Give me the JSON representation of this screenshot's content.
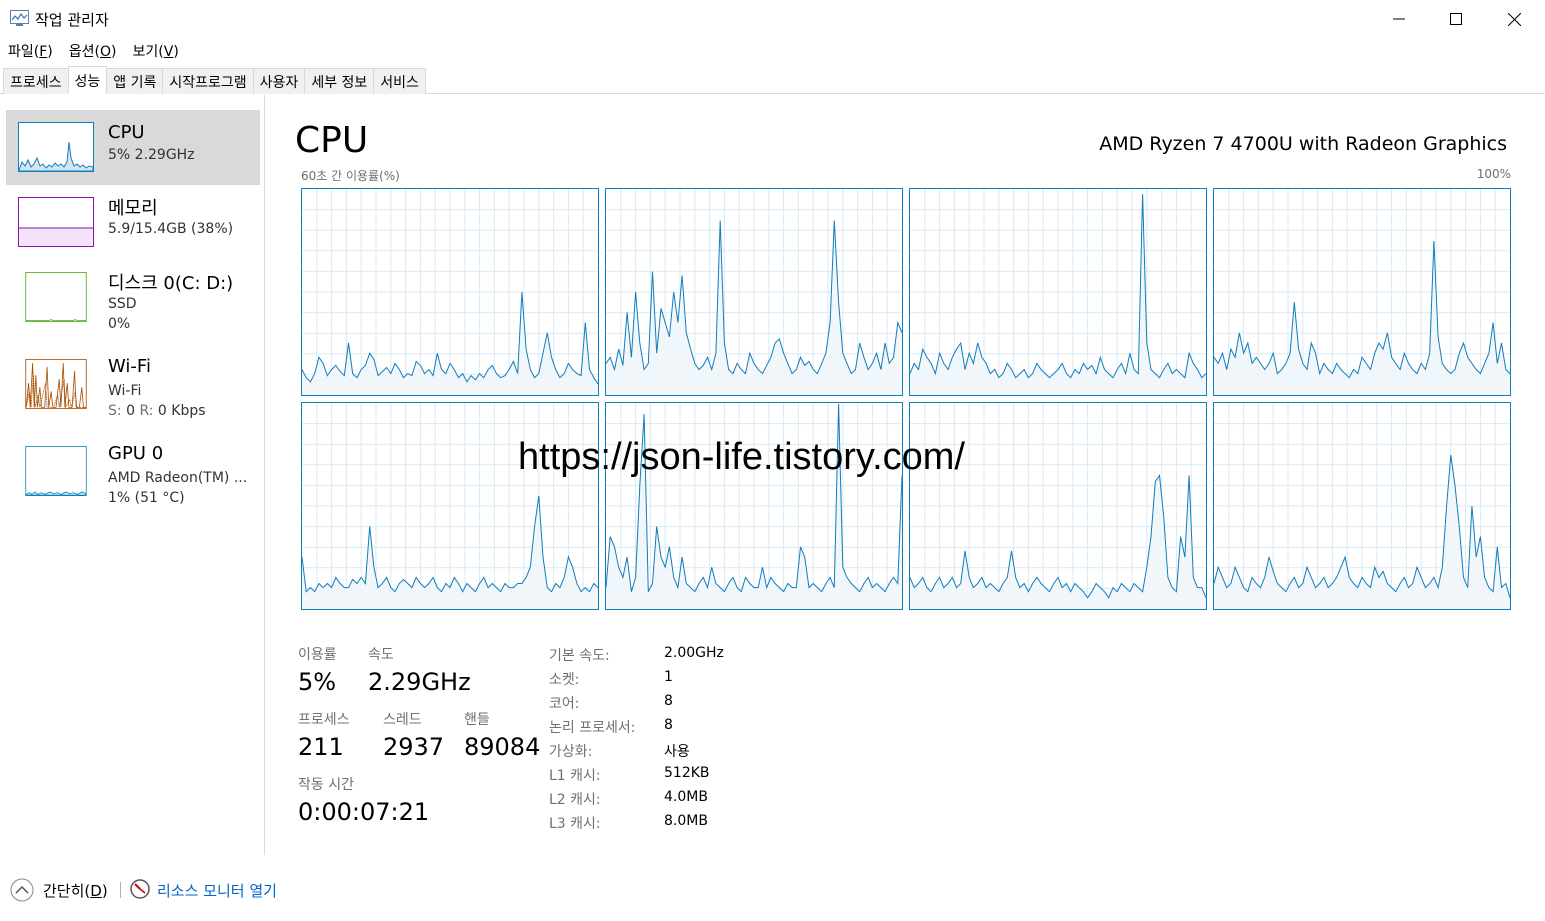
{
  "window": {
    "title": "작업 관리자",
    "icons": [
      "task-manager-icon",
      "minimize-icon",
      "maximize-icon",
      "close-icon"
    ]
  },
  "menu": [
    {
      "label": "파일(",
      "key": "F",
      "end": ")"
    },
    {
      "label": "옵션(",
      "key": "O",
      "end": ")"
    },
    {
      "label": "보기(",
      "key": "V",
      "end": ")"
    }
  ],
  "tabs": [
    "프로세스",
    "성능",
    "앱 기록",
    "시작프로그램",
    "사용자",
    "세부 정보",
    "서비스"
  ],
  "sidebar": {
    "cpu": {
      "name": "CPU",
      "sub": "5% 2.29GHz",
      "color": "#117dbb"
    },
    "memory": {
      "name": "메모리",
      "sub": "5.9/15.4GB (38%)",
      "color": "#8b12ae"
    },
    "disk": {
      "name": "디스크 0(C: D:)",
      "sub1": "SSD",
      "sub2": "0%",
      "color": "#4da60c"
    },
    "wifi": {
      "name": "Wi-Fi",
      "sub1": "Wi-Fi",
      "sub2_s": "S:",
      "sub2_sv": "0",
      "sub2_r": "R:",
      "sub2_rv": "0 Kbps",
      "color": "#a74f01"
    },
    "gpu": {
      "name": "GPU 0",
      "sub1": "AMD Radeon(TM) ...",
      "sub2": "1% (51 °C)",
      "color": "#117dbb"
    }
  },
  "main": {
    "title": "CPU",
    "model": "AMD Ryzen 7 4700U with Radeon Graphics",
    "graph_label": "60초 간 이용률(%)",
    "graph_max": "100%",
    "watermark": "https://json-life.tistory.com/"
  },
  "stats": {
    "utilization_label": "이용률",
    "utilization": "5%",
    "speed_label": "속도",
    "speed": "2.29GHz",
    "processes_label": "프로세스",
    "processes": "211",
    "threads_label": "스레드",
    "threads": "2937",
    "handles_label": "핸들",
    "handles": "89084",
    "uptime_label": "작동 시간",
    "uptime": "0:00:07:21"
  },
  "specs": [
    {
      "label": "기본 속도:",
      "value": "2.00GHz"
    },
    {
      "label": "소켓:",
      "value": "1"
    },
    {
      "label": "코어:",
      "value": "8"
    },
    {
      "label": "논리 프로세서:",
      "value": "8"
    },
    {
      "label": "가상화:",
      "value": "사용"
    },
    {
      "label": "L1 캐시:",
      "value": "512KB"
    },
    {
      "label": "L2 캐시:",
      "value": "4.0MB"
    },
    {
      "label": "L3 캐시:",
      "value": "8.0MB"
    }
  ],
  "footer": {
    "fewer_label": "간단히(",
    "fewer_key": "D",
    "fewer_end": ")",
    "resmon_label": "리소스 모니터 열기"
  },
  "chart_data": {
    "type": "area",
    "ylim": [
      0,
      100
    ],
    "color": "#117dbb",
    "series": [
      {
        "values": [
          12,
          8,
          6,
          10,
          18,
          15,
          9,
          12,
          14,
          11,
          9,
          25,
          10,
          8,
          12,
          14,
          20,
          17,
          9,
          11,
          13,
          10,
          15,
          12,
          8,
          10,
          9,
          16,
          14,
          10,
          12,
          9,
          20,
          12,
          10,
          15,
          12,
          8,
          10,
          6,
          9,
          7,
          10,
          8,
          12,
          14,
          10,
          8,
          9,
          12,
          16,
          10,
          50,
          22,
          12,
          8,
          10,
          20,
          30,
          18,
          12,
          8,
          10,
          15,
          12,
          10,
          9,
          35,
          12,
          8,
          5
        ]
      },
      {
        "values": [
          15,
          18,
          12,
          22,
          14,
          40,
          18,
          50,
          25,
          12,
          15,
          60,
          20,
          42,
          35,
          28,
          50,
          35,
          58,
          30,
          22,
          15,
          12,
          14,
          18,
          12,
          20,
          85,
          25,
          12,
          10,
          15,
          12,
          10,
          20,
          15,
          12,
          10,
          14,
          18,
          25,
          27,
          20,
          15,
          10,
          12,
          18,
          14,
          16,
          12,
          10,
          15,
          20,
          35,
          85,
          45,
          20,
          15,
          10,
          12,
          25,
          18,
          12,
          15,
          20,
          12,
          25,
          15,
          18,
          35,
          30
        ]
      },
      {
        "values": [
          10,
          15,
          12,
          22,
          18,
          15,
          10,
          20,
          15,
          12,
          18,
          22,
          25,
          12,
          20,
          15,
          25,
          18,
          15,
          10,
          12,
          8,
          10,
          15,
          12,
          8,
          10,
          12,
          8,
          10,
          15,
          12,
          10,
          8,
          10,
          12,
          15,
          10,
          8,
          12,
          10,
          15,
          12,
          14,
          10,
          18,
          12,
          10,
          8,
          12,
          15,
          10,
          20,
          12,
          10,
          98,
          25,
          12,
          10,
          8,
          12,
          15,
          10,
          12,
          10,
          8,
          20,
          15,
          12,
          8,
          10
        ]
      },
      {
        "values": [
          18,
          15,
          20,
          12,
          22,
          18,
          30,
          20,
          25,
          15,
          18,
          15,
          12,
          15,
          20,
          10,
          12,
          15,
          20,
          45,
          22,
          15,
          12,
          25,
          20,
          10,
          15,
          12,
          10,
          15,
          12,
          10,
          8,
          12,
          10,
          18,
          15,
          12,
          20,
          25,
          22,
          30,
          18,
          15,
          12,
          20,
          15,
          12,
          10,
          15,
          12,
          20,
          75,
          28,
          15,
          12,
          10,
          12,
          20,
          25,
          18,
          15,
          12,
          10,
          15,
          20,
          35,
          15,
          25,
          12,
          10
        ]
      },
      {
        "values": [
          25,
          8,
          10,
          8,
          12,
          10,
          12,
          10,
          15,
          12,
          10,
          10,
          14,
          12,
          15,
          12,
          40,
          20,
          10,
          12,
          15,
          10,
          8,
          12,
          14,
          12,
          10,
          15,
          12,
          10,
          12,
          15,
          10,
          8,
          12,
          10,
          15,
          12,
          8,
          12,
          10,
          8,
          12,
          15,
          10,
          12,
          10,
          8,
          12,
          10,
          10,
          12,
          12,
          15,
          20,
          40,
          55,
          25,
          10,
          8,
          12,
          10,
          15,
          25,
          20,
          12,
          8,
          10,
          8,
          12,
          10
        ]
      },
      {
        "values": [
          10,
          35,
          30,
          20,
          15,
          25,
          8,
          15,
          60,
          95,
          8,
          12,
          40,
          25,
          20,
          30,
          15,
          10,
          25,
          12,
          10,
          8,
          12,
          15,
          10,
          20,
          12,
          10,
          8,
          12,
          15,
          10,
          8,
          15,
          12,
          10,
          10,
          20,
          10,
          15,
          12,
          10,
          8,
          12,
          10,
          10,
          30,
          25,
          10,
          12,
          10,
          8,
          12,
          15,
          10,
          100,
          20,
          15,
          12,
          10,
          8,
          12,
          15,
          10,
          12,
          10,
          8,
          12,
          15,
          12,
          65
        ]
      },
      {
        "values": [
          15,
          10,
          12,
          15,
          10,
          8,
          12,
          15,
          10,
          12,
          15,
          10,
          12,
          28,
          15,
          10,
          12,
          15,
          10,
          12,
          10,
          8,
          12,
          15,
          28,
          15,
          10,
          12,
          8,
          12,
          15,
          12,
          10,
          8,
          12,
          15,
          10,
          12,
          8,
          12,
          10,
          8,
          5,
          8,
          12,
          10,
          8,
          5,
          10,
          8,
          12,
          10,
          8,
          12,
          10,
          8,
          20,
          35,
          62,
          65,
          45,
          15,
          10,
          8,
          35,
          25,
          65,
          15,
          10,
          10,
          5
        ]
      },
      {
        "values": [
          12,
          20,
          15,
          10,
          12,
          20,
          15,
          10,
          8,
          15,
          12,
          10,
          15,
          25,
          18,
          12,
          10,
          8,
          12,
          15,
          10,
          12,
          20,
          15,
          10,
          12,
          15,
          10,
          12,
          15,
          20,
          25,
          15,
          12,
          10,
          15,
          12,
          10,
          20,
          15,
          18,
          12,
          10,
          8,
          12,
          15,
          10,
          12,
          20,
          15,
          10,
          12,
          15,
          10,
          20,
          50,
          75,
          60,
          40,
          15,
          10,
          50,
          25,
          35,
          15,
          10,
          8,
          30,
          10,
          12,
          5
        ]
      }
    ]
  }
}
